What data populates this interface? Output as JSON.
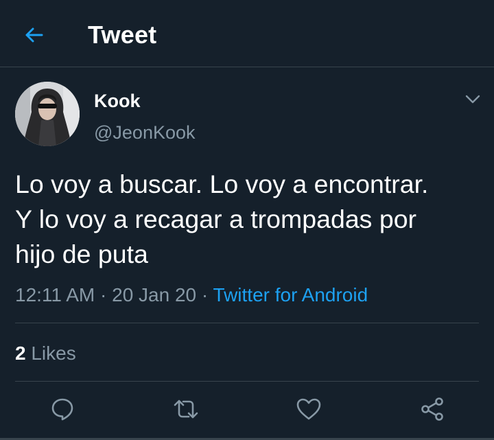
{
  "header": {
    "title": "Tweet",
    "back_icon": "arrow-left-icon"
  },
  "author": {
    "display_name": "Kook",
    "handle": "@JeonKook",
    "avatar_icon": "user-avatar"
  },
  "tweet": {
    "text": "Lo voy a buscar. Lo voy a encontrar.\nY lo voy a recagar a trompadas por\nhijo de puta",
    "time": "12:11 AM",
    "separator1": " · ",
    "date": "20 Jan 20",
    "separator2": " · ",
    "source": "Twitter for Android"
  },
  "stats": {
    "likes_count": "2",
    "likes_label": " Likes"
  },
  "actions": [
    {
      "name": "reply",
      "icon": "comment-icon"
    },
    {
      "name": "retweet",
      "icon": "retweet-icon"
    },
    {
      "name": "like",
      "icon": "heart-icon"
    },
    {
      "name": "share",
      "icon": "share-icon"
    }
  ],
  "colors": {
    "background": "#15202b",
    "text_primary": "#ffffff",
    "text_secondary": "#8899a6",
    "accent": "#1da1f2",
    "divider": "#38444d"
  }
}
